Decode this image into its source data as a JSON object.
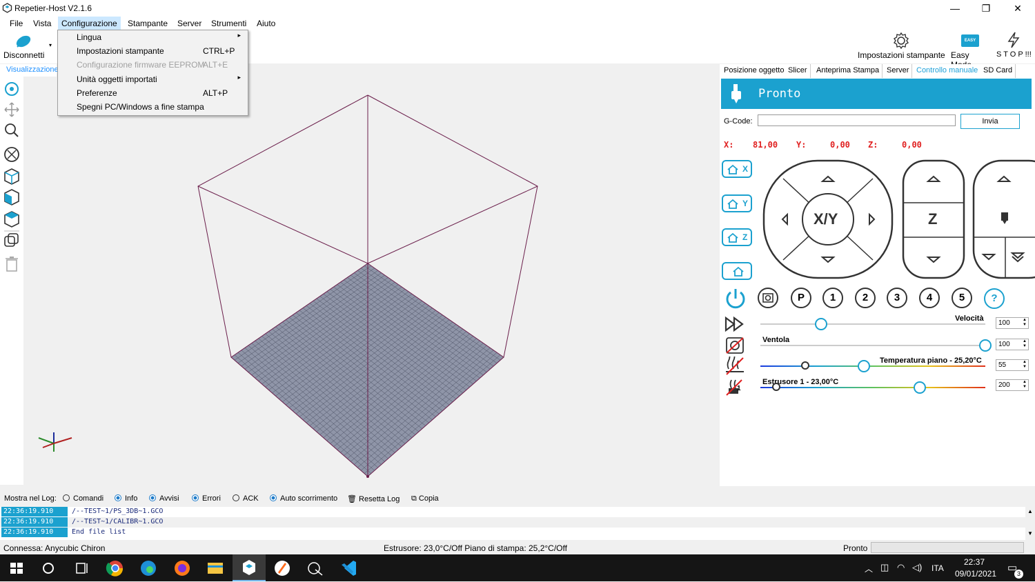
{
  "window": {
    "title": "Repetier-Host V2.1.6",
    "minimize": "—",
    "maximize": "❐",
    "close": "✕"
  },
  "menu": [
    "File",
    "Vista",
    "Configurazione",
    "Stampante",
    "Server",
    "Strumenti",
    "Aiuto"
  ],
  "toolbar": {
    "disconnect": "Disconnetti",
    "printer_settings": "Impostazioni stampante",
    "easy_mode": "Easy Mode",
    "easy_badge": "EASY",
    "stop": "S T O P !!!"
  },
  "dropdown": [
    {
      "label": "Lingua",
      "shortcut": "",
      "submenu": true,
      "disabled": false
    },
    {
      "label": "Impostazioni stampante",
      "shortcut": "CTRL+P",
      "submenu": false,
      "disabled": false
    },
    {
      "label": "Configurazione firmware EEPROM",
      "shortcut": "ALT+E",
      "submenu": false,
      "disabled": true
    },
    {
      "label": "Unità oggetti importati",
      "shortcut": "",
      "submenu": true,
      "disabled": false
    },
    {
      "label": "Preferenze",
      "shortcut": "ALT+P",
      "submenu": false,
      "disabled": false
    },
    {
      "label": "Spegni PC/Windows a fine stampa",
      "shortcut": "",
      "submenu": false,
      "disabled": false
    }
  ],
  "view_tab": "Visualizzazione",
  "right_tabs": [
    "Posizione oggetto",
    "Slicer",
    "Anteprima Stampa",
    "Server",
    "Controllo manuale",
    "SD Card"
  ],
  "manual": {
    "status": "Pronto",
    "gcode_label": "G-Code:",
    "gcode_value": "",
    "send": "Invia",
    "x_label": "X:",
    "x_value": "81,00",
    "y_label": "Y:",
    "y_value": "0,00",
    "z_label": "Z:",
    "z_value": "0,00",
    "home_x": "X",
    "home_y": "Y",
    "home_z": "Z",
    "xy_label": "X/Y",
    "z_pad_label": "Z",
    "macro_buttons": [
      "P",
      "1",
      "2",
      "3",
      "4",
      "5",
      "?"
    ],
    "speed_label": "Velocità",
    "speed_value": "100",
    "speed_level": 0.27,
    "fan_label": "Ventola",
    "fan_value": "100",
    "fan_level": 1.0,
    "bed_label": "Temperatura piano - 25,20°C",
    "bed_value": "55",
    "bed_current_level": 0.2,
    "bed_target_level": 0.46,
    "extruder_label": "Estrusore 1 - 23,00°C",
    "extruder_value": "200",
    "extruder_current_level": 0.07,
    "extruder_target_level": 0.71,
    "extruder_index": "1"
  },
  "log": {
    "show_label": "Mostra nel Log:",
    "options": [
      {
        "label": "Comandi",
        "on": false
      },
      {
        "label": "Info",
        "on": true
      },
      {
        "label": "Avvisi",
        "on": true
      },
      {
        "label": "Errori",
        "on": true
      },
      {
        "label": "ACK",
        "on": false
      },
      {
        "label": "Auto scorrimento",
        "on": true
      }
    ],
    "reset": "Resetta Log",
    "copy": "Copia",
    "rows": [
      {
        "time": "22:36:19.910",
        "msg": "/--TEST~1/PS_3DB~1.GCO"
      },
      {
        "time": "22:36:19.910",
        "msg": "/--TEST~1/CALIBR~1.GCO"
      },
      {
        "time": "22:36:19.910",
        "msg": "End file list"
      }
    ]
  },
  "status": {
    "connected": "Connessa: Anycubic Chiron",
    "temps": "Estrusore: 23,0°C/Off Piano di stampa: 25,2°C/Off",
    "state": "Pronto"
  },
  "taskbar": {
    "time": "22:37",
    "date": "09/01/2021",
    "lang": "ITA",
    "notif_count": "3"
  },
  "colors": {
    "accent": "#1ba1cf",
    "coord_red": "#e02020",
    "bed_grid": "#8f95a8",
    "box_edges": "#6a1d4a"
  }
}
